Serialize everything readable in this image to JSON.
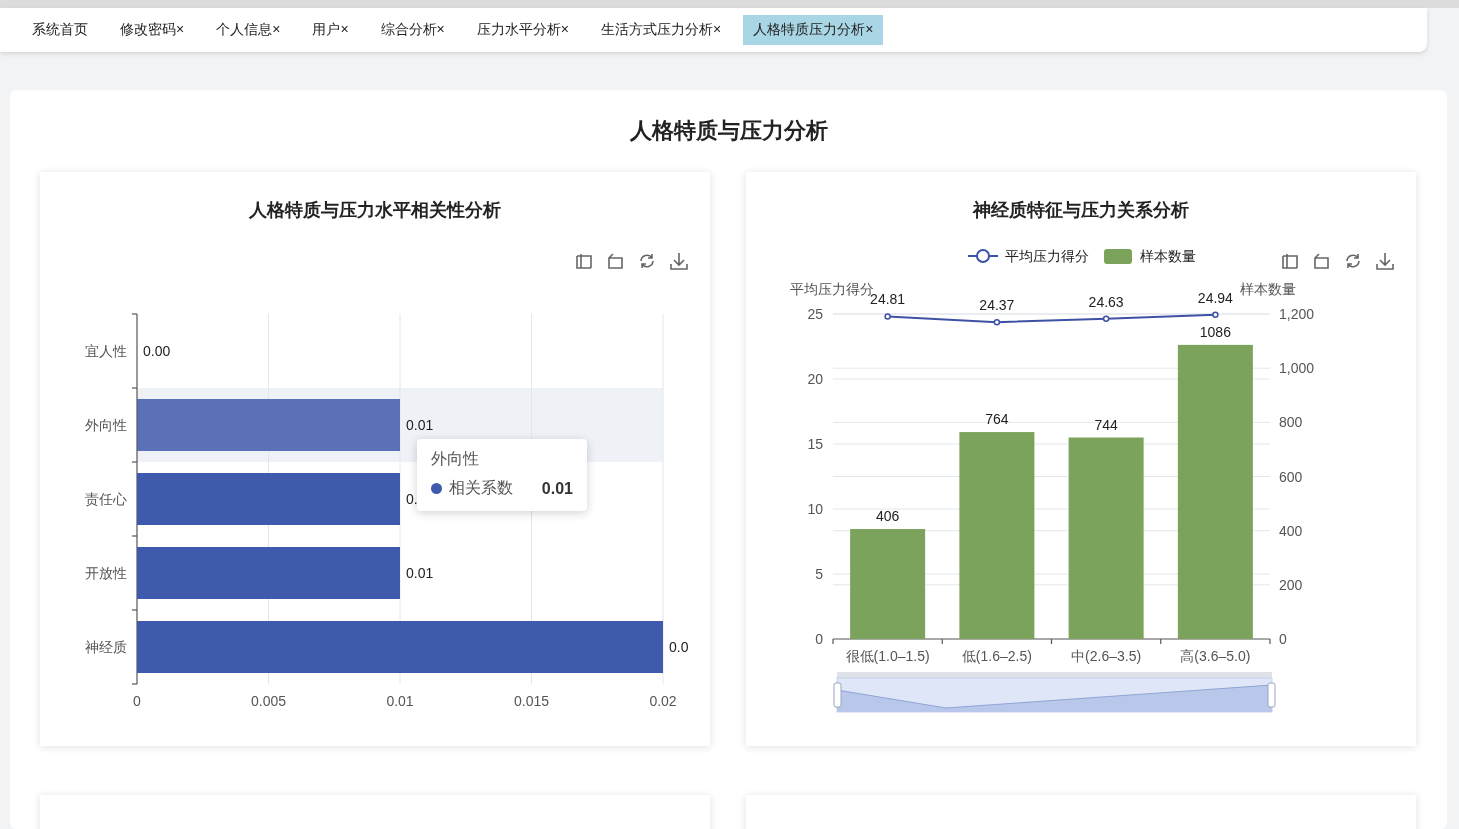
{
  "tabs": [
    {
      "label": "系统首页",
      "selected": false
    },
    {
      "label": "修改密码",
      "close": "×",
      "selected": false
    },
    {
      "label": "个人信息",
      "close": "×",
      "selected": false
    },
    {
      "label": "用户",
      "close": "×",
      "selected": false
    },
    {
      "label": "综合分析",
      "close": "×",
      "selected": false
    },
    {
      "label": "压力水平分析",
      "close": "×",
      "selected": false
    },
    {
      "label": "生活方式压力分析",
      "close": "×",
      "selected": false
    },
    {
      "label": "人格特质压力分析",
      "close": "×",
      "selected": true
    }
  ],
  "page_title": "人格特质与压力分析",
  "cards": [
    {
      "title": "人格特质与压力水平相关性分析",
      "chart_data": {
        "type": "bar",
        "orientation": "horizontal",
        "grid": true,
        "categories": [
          "宜人性",
          "外向性",
          "责任心",
          "开放性",
          "神经质"
        ],
        "series": [
          {
            "name": "相关系数",
            "color": "#3f5aad",
            "values": [
              0,
              0.01,
              0.01,
              0.01,
              0.02
            ]
          }
        ],
        "xlim": [
          0,
          0.02
        ],
        "xticks": [
          {
            "value": 0,
            "label": "0"
          },
          {
            "value": 0.005,
            "label": "0.005"
          },
          {
            "value": 0.01,
            "label": "0.01"
          },
          {
            "value": 0.015,
            "label": "0.015"
          },
          {
            "value": 0.02,
            "label": "0.02"
          }
        ],
        "value_labels": [
          "0.00",
          "0.01",
          "0.",
          "0.01",
          "0.0"
        ]
      },
      "hovered": [
        false,
        true,
        false,
        false,
        false
      ],
      "tooltip": {
        "title": "外向性",
        "value": "0.01"
      }
    },
    {
      "title": "神经质特征与压力关系分析",
      "chart_data": {
        "type": "bar",
        "grid": true,
        "legend": "top",
        "categories": [
          "很低(1.0–1.5)",
          "低(1.6–2.5)",
          "中(2.6–3.5)",
          "高(3.6–5.0)"
        ],
        "series": [
          {
            "name": "平均压力得分",
            "type": "line",
            "marker": "circle",
            "color": "#3f51a5",
            "values": [
              24.81,
              24.37,
              24.63,
              24.94
            ]
          },
          {
            "name": "样本数量",
            "type": "bar",
            "axis": "y2",
            "color": "#7ba35b",
            "values": [
              406,
              764,
              744,
              1086
            ]
          }
        ],
        "ylabel": "平均压力得分",
        "y2label": "样本数量",
        "ylim": [
          0,
          25
        ],
        "yticks": [
          0,
          5,
          10,
          15,
          20,
          25
        ],
        "y2lim": [
          0,
          1200
        ],
        "y2ticks": [
          {
            "value": 0,
            "label": "0"
          },
          {
            "value": 200,
            "label": "200"
          },
          {
            "value": 400,
            "label": "400"
          },
          {
            "value": 600,
            "label": "600"
          },
          {
            "value": 800,
            "label": "800"
          },
          {
            "value": 1000,
            "label": "1,000"
          },
          {
            "value": 1200,
            "label": "1,200"
          }
        ],
        "data_labels": true
      }
    }
  ],
  "lower_cards": [
    {
      "kind": "empty"
    },
    {
      "kind": "empty"
    }
  ]
}
